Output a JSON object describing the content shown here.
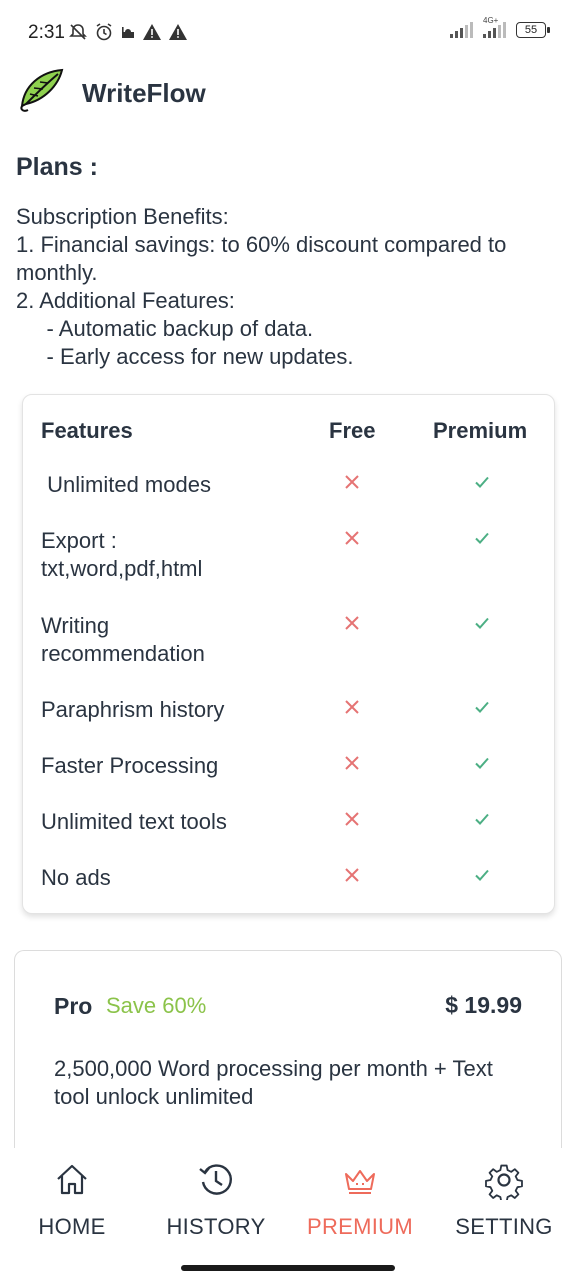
{
  "status_bar": {
    "time": "2:31",
    "network_label": "4G+",
    "battery": "55"
  },
  "header": {
    "app_title": "WriteFlow",
    "logo_icon": "feather-logo"
  },
  "plans": {
    "title": "Plans :",
    "benefits": [
      "Subscription Benefits:",
      "1. Financial savings: to 60% discount compared to",
      "monthly.",
      "2. Additional Features:",
      "     - Automatic backup of data.",
      "     - Early access for new updates."
    ]
  },
  "features_table": {
    "headers": {
      "feature": "Features",
      "free": "Free",
      "premium": "Premium"
    },
    "rows": [
      {
        "label": " Unlimited modes",
        "free": false,
        "premium": true
      },
      {
        "label": "Export :\ntxt,word,pdf,html",
        "free": false,
        "premium": true
      },
      {
        "label": "Writing\nrecommendation",
        "free": false,
        "premium": true
      },
      {
        "label": "Paraphrism history",
        "free": false,
        "premium": true
      },
      {
        "label": "Faster Processing",
        "free": false,
        "premium": true
      },
      {
        "label": "Unlimited text tools",
        "free": false,
        "premium": true
      },
      {
        "label": "No ads",
        "free": false,
        "premium": true
      }
    ],
    "colors": {
      "cross": "#e57373",
      "check": "#4caf84"
    }
  },
  "pro_plan": {
    "name": "Pro",
    "save": "Save 60%",
    "price": "$ 19.99",
    "description": "2,500,000 Word processing per month + Text tool unlock unlimited",
    "save_color": "#8bc34a"
  },
  "bottom_nav": {
    "items": [
      {
        "label": "HOME",
        "icon": "home-icon"
      },
      {
        "label": "HISTORY",
        "icon": "history-icon"
      },
      {
        "label": "PREMIUM",
        "icon": "crown-icon"
      },
      {
        "label": "SETTING",
        "icon": "gear-icon"
      }
    ],
    "active": "PREMIUM",
    "active_color": "#ee6b5b"
  }
}
